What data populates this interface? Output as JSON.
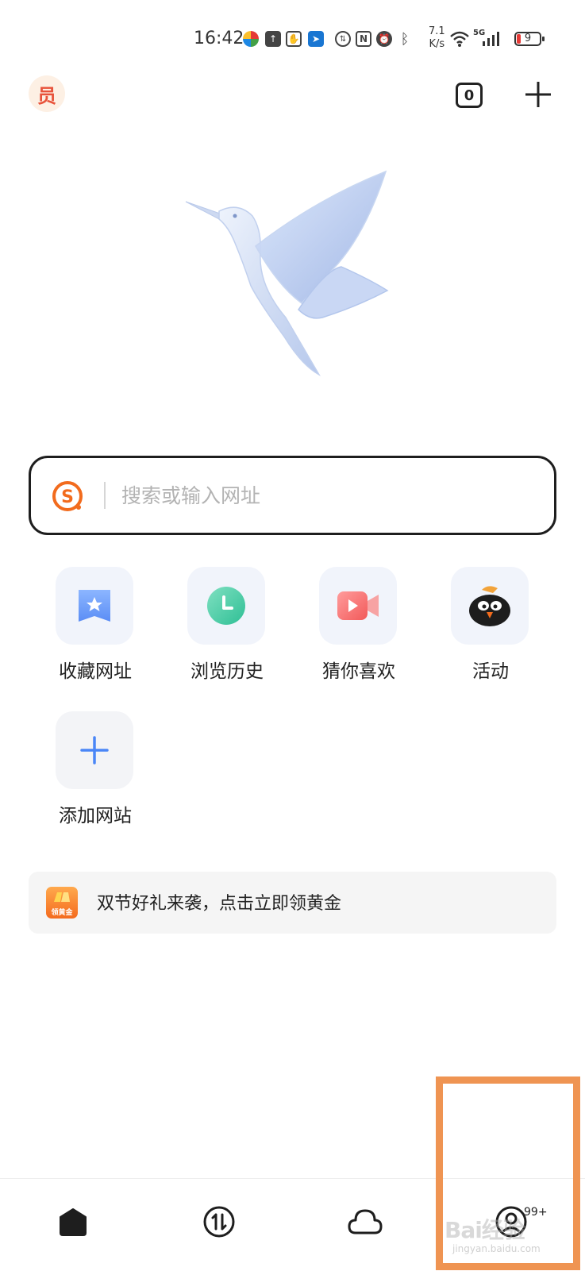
{
  "status_bar": {
    "time": "16:42",
    "net_speed_value": "7.1",
    "net_speed_unit": "K/s",
    "signal_label": "5G",
    "battery": "9"
  },
  "header": {
    "member_badge": "员",
    "tab_count": "0"
  },
  "search": {
    "placeholder": "搜索或输入网址"
  },
  "shortcuts": [
    {
      "label": "收藏网址",
      "icon": "bookmark-star-icon"
    },
    {
      "label": "浏览历史",
      "icon": "clock-icon"
    },
    {
      "label": "猜你喜欢",
      "icon": "video-camera-icon"
    },
    {
      "label": "活动",
      "icon": "penguin-mascot-icon"
    },
    {
      "label": "添加网站",
      "icon": "plus-icon"
    }
  ],
  "promo": {
    "icon_label": "领黄金",
    "text": "双节好礼来袭，点击立即领黄金"
  },
  "bottom_nav": {
    "items": [
      "home-icon",
      "transfer-icon",
      "cloud-icon",
      "profile-icon"
    ],
    "profile_badge": "99+"
  },
  "watermark": {
    "text": "Bai经验",
    "sub": "jingyan.baidu.com"
  },
  "colors": {
    "accent_orange": "#f26b1d",
    "highlight": "#ef9452",
    "tile_bg": "#f1f4fb",
    "text_primary": "#222222",
    "placeholder": "#b3b3b3"
  }
}
